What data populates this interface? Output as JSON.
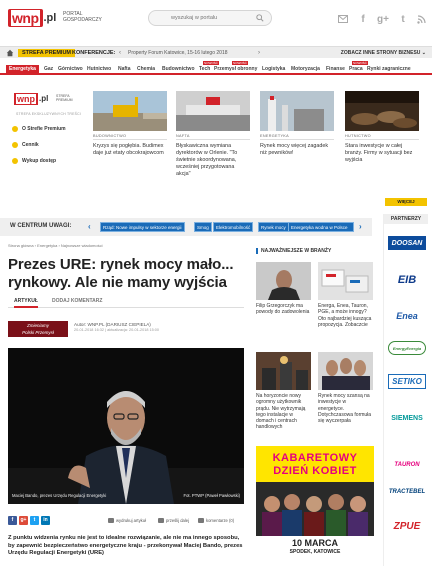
{
  "header": {
    "logo_main": "wnp",
    "logo_suffix": ".pl",
    "portal_line1": "PORTAL",
    "portal_line2": "GOSPODARCZY",
    "search_placeholder": "wyszukaj w portalu"
  },
  "navbar": {
    "premium_label": "STREFA PREMIUM",
    "konf_label": "KONFERENCJE:",
    "event": "Property Forum Katowice, 15-16 lutego 2018",
    "zobacz": "ZOBACZ INNE STRONY BIZNESU ⌄"
  },
  "categories": {
    "active": "Energetyka",
    "items": [
      "Gaz",
      "Górnictwo",
      "Hutnictwo",
      "Nafta",
      "Chemia",
      "Budownictwo",
      "Tech",
      "Przemysł obronny",
      "Logistyka",
      "Motoryzacja",
      "Finanse",
      "Praca",
      "Rynki zagraniczne"
    ],
    "nowosc": "NOWOŚĆ"
  },
  "premium": {
    "logo_main": "wnp",
    "logo_suffix": ".pl",
    "strefa_line1": "STREFA",
    "strefa_line2": "PREMIUM",
    "sub": "STREFA EKSKLUZYWNYCH TREŚCI",
    "items": [
      "O Strefie Premium",
      "Cennik",
      "Wykup dostęp"
    ]
  },
  "news": [
    {
      "label": "BUDOWNICTWO",
      "title": "Kryzys się pogłębia. Budimex daje już etaty obcokrajowcom"
    },
    {
      "label": "NAFTA",
      "title": "Błyskawiczna wymiana dyrektorów w Orlenie. \"To świetnie skoordynowana, wcześniej przygotowana akcja\""
    },
    {
      "label": "ENERGETYKA",
      "title": "Rynek mocy więcej zagadek niż pewników!"
    },
    {
      "label": "HUTNICTWO",
      "title": "Stara inwestycje w całej branży. Firmy w sytuacji bez wyjścia"
    }
  ],
  "more_label": "WIĘCEJ",
  "focus": {
    "label": "W CENTRUM UWAGI:",
    "tags": [
      "Rząd: Nowe impulsy w sektorze energii",
      "Smog",
      "Elektromobilność",
      "Rynek mocy",
      "Energetyka wodna w Polsce"
    ]
  },
  "partners": {
    "head": "PARTNERZY",
    "items": [
      "DOOSAN",
      "EIB",
      "Enea",
      "EnergyEnergia",
      "SETIKO",
      "SIEMENS",
      "TAURON",
      "TRACTEBEL",
      "ZPUE"
    ]
  },
  "breadcrumb": "Strona główna  ›  Energetyka  ›  Najnowsze wiadomości",
  "article": {
    "title": "Prezes URE: rynek mocy mało... rynkowy. Ale nie mamy wyjścia",
    "tab1": "ARTYKUŁ",
    "tab2": "DODAJ KOMENTARZ",
    "badge_line1": "Zmieniamy",
    "badge_line2": "Polski Przemysł",
    "author": "Autor: WNP.PL (DARIUSZ CIEPIELA)",
    "date": "20-01-2018 16:32  |  aktualizacja: 20-01-2018 15:00",
    "caption": "Maciej Bando, prezes Urzędu Regulacji Energetyki",
    "photo_credit": "Fot. PTWP (Paweł Pawłowski)",
    "share_buttons": [
      "f",
      "g+",
      "t",
      "in"
    ],
    "actions": [
      "wydrukuj artykuł",
      "prześlij dalej",
      "komentarze (0)"
    ],
    "lead": "Z punktu widzenia rynku nie jest to idealne rozwiązanie, ale nie ma innego sposobu, by zapewnić bezpieczeństwo energetyczne kraju - przekonywał Maciej Bando, prezes Urzędu Regulacji Energetyki (URE)"
  },
  "popular": {
    "head": "NAJWAŻNIEJSZE W BRANŻY",
    "items": [
      "Filip Grzegorczyk ma powody do zadowolenia",
      "Energa, Enea, Tauron, PGE, a może innogy? Oto najbardziej kusząca propozycja. Zobaczcie",
      "Na horyzoncie nowy ogromny użytkownik prądu. Nie wytrzymają tego instalacje w domach i centrach handlowych",
      "Rynek mocy szansą na inwestycje w energetyce. Dotychczasowa formuła się wyczerpała"
    ]
  },
  "ad": {
    "label": "REKLAMA",
    "line1": "KABARETOWY",
    "line2": "DZIEŃ KOBIET",
    "date": "10 MARCA",
    "city": "SPODEK, KATOWICE"
  },
  "colors": {
    "brand": "#d2232a",
    "premium": "#f3c300",
    "link": "#1a6bb8"
  }
}
